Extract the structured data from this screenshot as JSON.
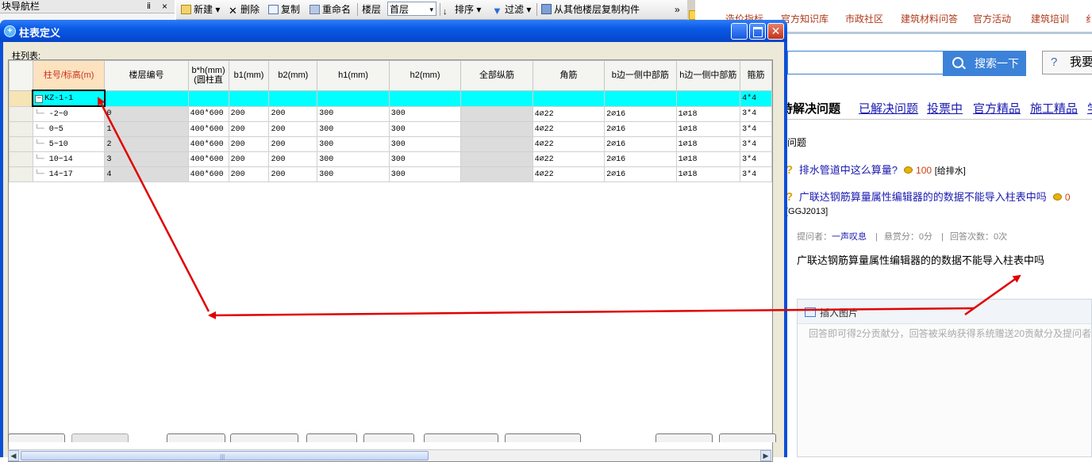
{
  "nav": {
    "title": "块导航栏",
    "pin": "ⅱ",
    "close": "×"
  },
  "toolbar": {
    "new": "新建",
    "delete": "删除",
    "copy": "复制",
    "rename": "重命名",
    "floor_label": "楼层",
    "floor_value": "首层",
    "sort": "排序",
    "filter": "过滤",
    "copy_from": "从其他楼层复制构件",
    "more": "»"
  },
  "browser": {
    "nav_links": [
      "造价指标",
      "官方知识库",
      "市政社区",
      "建筑材料问答",
      "官方活动",
      "建筑培训",
      "纟"
    ],
    "search_button": "搜索一下",
    "ask_button": "我要",
    "tabs": [
      "待解决问题",
      "已解决问题",
      "投票中",
      "官方精品",
      "施工精品",
      "学"
    ],
    "section_title": "问题",
    "q1": {
      "title": "排水管道中这么算量?",
      "points": "100",
      "tag": "[给排水]"
    },
    "q2": {
      "title": "广联达钢筋算量属性编辑器的的数据不能导入柱表中吗",
      "points": "0",
      "tag": "[GGJ2013]"
    },
    "meta": {
      "asker_label": "提问者：",
      "asker": "一声叹息",
      "sep1": "|",
      "reward": "悬赏分：0分",
      "sep2": "|",
      "answers": "回答次数：0次"
    },
    "question_body": "广联达钢筋算量属性编辑器的的数据不能导入柱表中吗",
    "insert_image": "插入图片",
    "answer_placeholder": "回答即可得2分贡献分，回答被采纳获得系统赠送20贡献分及提问者"
  },
  "dialog": {
    "title": "柱表定义",
    "list_label": "柱列表:",
    "columns": [
      "柱号/标高(m)",
      "楼层编号",
      "b*h(mm)(圆柱直",
      "b1(mm)",
      "b2(mm)",
      "h1(mm)",
      "h2(mm)",
      "全部纵筋",
      "角筋",
      "b边一侧中部筋",
      "h边一侧中部筋",
      "箍筋"
    ],
    "group_row": {
      "name": "KZ-1-1",
      "stirrup": "4*4"
    },
    "rows": [
      {
        "name": "-2~0",
        "floor": "0",
        "bh": "400*600",
        "b1": "200",
        "b2": "200",
        "h1": "300",
        "h2": "300",
        "all": "",
        "corner": "4⌀22",
        "bmid": "2⌀16",
        "hmid": "1⌀18",
        "stirrup": "3*4"
      },
      {
        "name": "0~5",
        "floor": "1",
        "bh": "400*600",
        "b1": "200",
        "b2": "200",
        "h1": "300",
        "h2": "300",
        "all": "",
        "corner": "4⌀22",
        "bmid": "2⌀16",
        "hmid": "1⌀18",
        "stirrup": "3*4"
      },
      {
        "name": "5~10",
        "floor": "2",
        "bh": "400*600",
        "b1": "200",
        "b2": "200",
        "h1": "300",
        "h2": "300",
        "all": "",
        "corner": "4⌀22",
        "bmid": "2⌀16",
        "hmid": "1⌀18",
        "stirrup": "3*4"
      },
      {
        "name": "10~14",
        "floor": "3",
        "bh": "400*600",
        "b1": "200",
        "b2": "200",
        "h1": "300",
        "h2": "300",
        "all": "",
        "corner": "4⌀22",
        "bmid": "2⌀16",
        "hmid": "1⌀18",
        "stirrup": "3*4"
      },
      {
        "name": "14~17",
        "floor": "4",
        "bh": "400*600",
        "b1": "200",
        "b2": "200",
        "h1": "300",
        "h2": "300",
        "all": "",
        "corner": "4⌀22",
        "bmid": "2⌀16",
        "hmid": "1⌀18",
        "stirrup": "3*4"
      }
    ]
  },
  "colors": {
    "highlight": "#00ffff",
    "title_bar": "#0a5ae6",
    "annotation_arrow": "#e00000",
    "link": "#1a1ab0",
    "nav_link": "#b0391a"
  }
}
